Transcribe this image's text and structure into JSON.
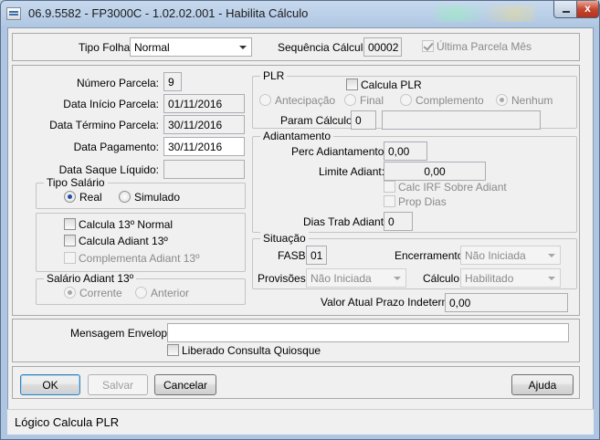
{
  "window": {
    "title": "06.9.5582 - FP3000C - 1.02.02.001 - Habilita Cálculo",
    "close_glyph": "x"
  },
  "top": {
    "tipo_folha_label": "Tipo Folha:",
    "tipo_folha_value": "Normal",
    "sequencia_label": "Sequência Cálculo:",
    "sequencia_value": "00002",
    "ultima_parcela_label": "Última Parcela Mês"
  },
  "left": {
    "numero_parcela_label": "Número Parcela:",
    "numero_parcela_value": "9",
    "data_inicio_label": "Data Início Parcela:",
    "data_inicio_value": "01/11/2016",
    "data_termino_label": "Data Término Parcela:",
    "data_termino_value": "30/11/2016",
    "data_pagamento_label": "Data Pagamento:",
    "data_pagamento_value": "30/11/2016",
    "data_saque_label": "Data Saque Líquido:",
    "data_saque_value": "",
    "tipo_salario": {
      "title": "Tipo Salário",
      "real": "Real",
      "simulado": "Simulado"
    },
    "calcula_13_normal": "Calcula 13º Normal",
    "calcula_adiant_13": "Calcula Adiant 13º",
    "complementa_adiant_13": "Complementa Adiant 13º",
    "salario_adiant": {
      "title": "Salário Adiant 13º",
      "corrente": "Corrente",
      "anterior": "Anterior"
    }
  },
  "plr": {
    "title": "PLR",
    "calcula_plr": "Calcula PLR",
    "antecipacao": "Antecipação",
    "final": "Final",
    "complemento": "Complemento",
    "nenhum": "Nenhum",
    "param_label": "Param Cálculo:",
    "param_value": "0",
    "param_desc": ""
  },
  "adiantamento": {
    "title": "Adiantamento",
    "perc_label": "Perc Adiantamento:",
    "perc_value": "0,00",
    "limite_label": "Limite Adiant:",
    "limite_value": "0,00",
    "calc_irf": "Calc IRF Sobre Adiant",
    "prop_dias": "Prop Dias",
    "dias_trab_label": "Dias Trab Adiant:",
    "dias_trab_value": "0"
  },
  "situacao": {
    "title": "Situação",
    "fasb_label": "FASB:",
    "fasb_value": "01",
    "encerramento_label": "Encerramento:",
    "encerramento_value": "Não Iniciada",
    "provisoes_label": "Provisões:",
    "provisoes_value": "Não Iniciada",
    "calculo_label": "Cálculo:",
    "calculo_value": "Habilitado"
  },
  "valor_atual": {
    "label": "Valor Atual Prazo Indeterm:",
    "value": "0,00"
  },
  "mensagem": {
    "label": "Mensagem Envelope:",
    "value": "",
    "liberado": "Liberado Consulta Quiosque"
  },
  "buttons": {
    "ok": "OK",
    "salvar": "Salvar",
    "cancelar": "Cancelar",
    "ajuda": "Ajuda"
  },
  "status": {
    "text": "Lógico Calcula PLR"
  }
}
